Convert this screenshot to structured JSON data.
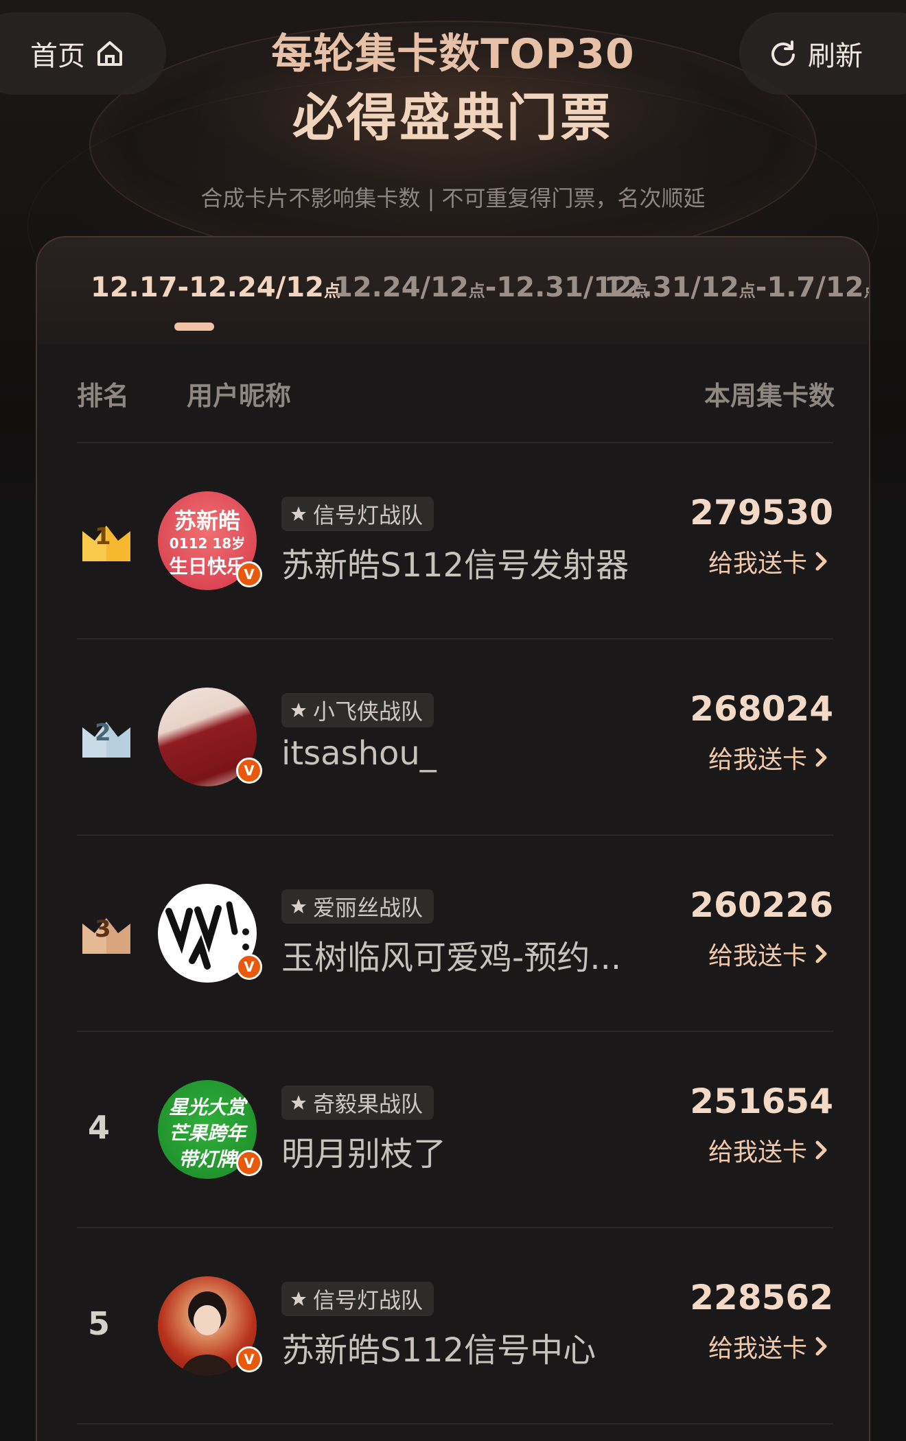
{
  "nav": {
    "home_label": "首页",
    "home_icon": "house-icon",
    "refresh_label": "刷新",
    "refresh_icon": "refresh-icon"
  },
  "header": {
    "title_line1": "每轮集卡数TOP30",
    "title_line2": "必得盛典门票",
    "subtitle": "合成卡片不影响集卡数 | 不可重复得门票，名次顺延"
  },
  "tabs": [
    {
      "main": "12.17-12.24/12",
      "suffix": "点",
      "active": true
    },
    {
      "part1": "12.24/12",
      "suffix1": "点",
      "part2": "-12.31/12",
      "suffix2": "点",
      "active": false
    },
    {
      "part1": "12.31/12",
      "suffix1": "点",
      "part2": "-1.7/12",
      "suffix2": "点",
      "active": false
    }
  ],
  "columns": {
    "rank": "排名",
    "nickname": "用户昵称",
    "cards": "本周集卡数"
  },
  "rows": [
    {
      "rank": "1",
      "rank_style": "gold-crown",
      "team": "信号灯战队",
      "username": "苏新皓S112信号发射器",
      "count": "279530",
      "send_label": "给我送卡",
      "avatar": {
        "line1": "苏新皓",
        "line2": "0112 18岁",
        "line3": "生日快乐"
      }
    },
    {
      "rank": "2",
      "rank_style": "silver-crown",
      "team": "小飞侠战队",
      "username": "itsashou_",
      "count": "268024",
      "send_label": "给我送卡"
    },
    {
      "rank": "3",
      "rank_style": "bronze-crown",
      "team": "爱丽丝战队",
      "username": "玉树临风可爱鸡-预约...",
      "count": "260226",
      "send_label": "给我送卡"
    },
    {
      "rank": "4",
      "rank_style": "plain",
      "team": "奇毅果战队",
      "username": "明月别枝了",
      "count": "251654",
      "send_label": "给我送卡",
      "avatar": {
        "line1": "星光大赏",
        "line2": "芒果跨年",
        "line3": "带灯牌"
      }
    },
    {
      "rank": "5",
      "rank_style": "plain",
      "team": "信号灯战队",
      "username": "苏新皓S112信号中心",
      "count": "228562",
      "send_label": "给我送卡"
    }
  ],
  "colors": {
    "background": "#131212",
    "panel": "#1a1818",
    "accent": "#f0c2a6",
    "count_text": "#f4dac6",
    "verified_badge": "#e8590c",
    "gold": "#f5b82e",
    "silver": "#b8cfe0",
    "bronze": "#d9a57f"
  }
}
